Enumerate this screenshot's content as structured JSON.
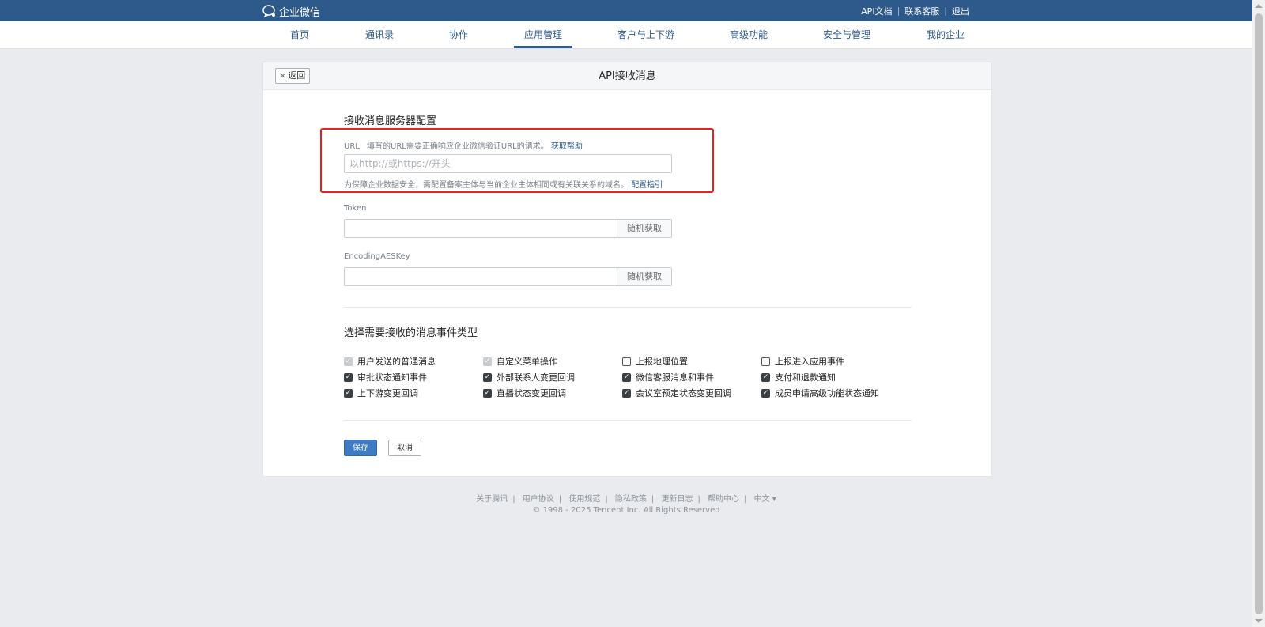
{
  "topbar": {
    "logo_text": "企业微信",
    "links": [
      "API文档",
      "联系客服",
      "退出"
    ]
  },
  "nav": {
    "items": [
      "首页",
      "通讯录",
      "协作",
      "应用管理",
      "客户与上下游",
      "高级功能",
      "安全与管理",
      "我的企业"
    ],
    "active": "应用管理"
  },
  "card": {
    "back_label": "« 返回",
    "title": "API接收消息",
    "server_section_title": "接收消息服务器配置",
    "url": {
      "label": "URL",
      "hint": "填写的URL需要正确响应企业微信验证URL的请求。",
      "hint_link": "获取帮助",
      "placeholder": "以http://或https://开头",
      "note": "为保障企业数据安全，需配置备案主体与当前企业主体相同或有关联关系的域名。",
      "note_link": "配置指引"
    },
    "token": {
      "label": "Token",
      "value": "",
      "random_button": "随机获取"
    },
    "aes": {
      "label": "EncodingAESKey",
      "value": "",
      "random_button": "随机获取"
    },
    "events_section_title": "选择需要接收的消息事件类型",
    "events": [
      {
        "label": "用户发送的普通消息",
        "checked": true,
        "disabled": true
      },
      {
        "label": "自定义菜单操作",
        "checked": true,
        "disabled": true
      },
      {
        "label": "上报地理位置",
        "checked": false,
        "disabled": false
      },
      {
        "label": "上报进入应用事件",
        "checked": false,
        "disabled": false
      },
      {
        "label": "审批状态通知事件",
        "checked": true,
        "disabled": false
      },
      {
        "label": "外部联系人变更回调",
        "checked": true,
        "disabled": false
      },
      {
        "label": "微信客服消息和事件",
        "checked": true,
        "disabled": false
      },
      {
        "label": "支付和退款通知",
        "checked": true,
        "disabled": false
      },
      {
        "label": "上下游变更回调",
        "checked": true,
        "disabled": false
      },
      {
        "label": "直播状态变更回调",
        "checked": true,
        "disabled": false
      },
      {
        "label": "会议室预定状态变更回调",
        "checked": true,
        "disabled": false
      },
      {
        "label": "成员申请高级功能状态通知",
        "checked": true,
        "disabled": false
      }
    ],
    "save_button": "保存",
    "cancel_button": "取消"
  },
  "footer": {
    "links": [
      "关于腾讯",
      "用户协议",
      "使用规范",
      "隐私政策",
      "更新日志",
      "帮助中心",
      "中文 ▾"
    ],
    "copyright": "© 1998 - 2025 Tencent Inc. All Rights Reserved"
  },
  "colors": {
    "brand": "#2e5a8b",
    "primary_button": "#3d7bc2",
    "highlight_box": "#e3231d"
  }
}
